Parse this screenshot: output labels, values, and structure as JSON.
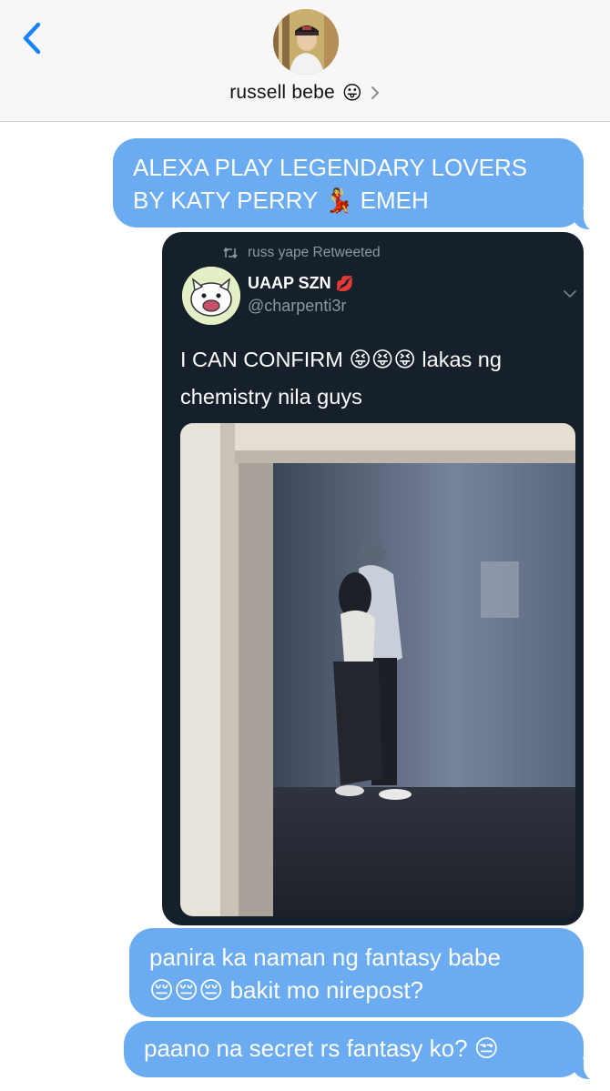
{
  "header": {
    "contact_name": "russell bebe",
    "contact_emoji": "😛"
  },
  "messages": [
    {
      "text_line1": "ALEXA PLAY LEGENDARY LOVERS",
      "text_line2_a": "BY KATY PERRY",
      "emoji": "💃",
      "text_line2_b": "EMEH"
    },
    {
      "text_line1": "panira ka naman ng fantasy babe",
      "emojis": "😔😔😔",
      "text_line2": "bakit mo nirepost?"
    },
    {
      "text": "paano na secret rs fantasy ko?",
      "emoji": "😒"
    }
  ],
  "tweet": {
    "retweet_label": "russ yape Retweeted",
    "author_name": "UAAP SZN",
    "author_emoji": "💋",
    "handle": "@charpenti3r",
    "text_line1": "I CAN CONFIRM",
    "text_emojis": "😝😝😝",
    "text_line1_b": "lakas ng",
    "text_line2": "chemistry nila guys"
  },
  "colors": {
    "bubble_blue": "#6aabf2",
    "ios_blue": "#1a82fb",
    "tweet_bg": "#16202b",
    "tweet_secondary": "#8899a6"
  }
}
